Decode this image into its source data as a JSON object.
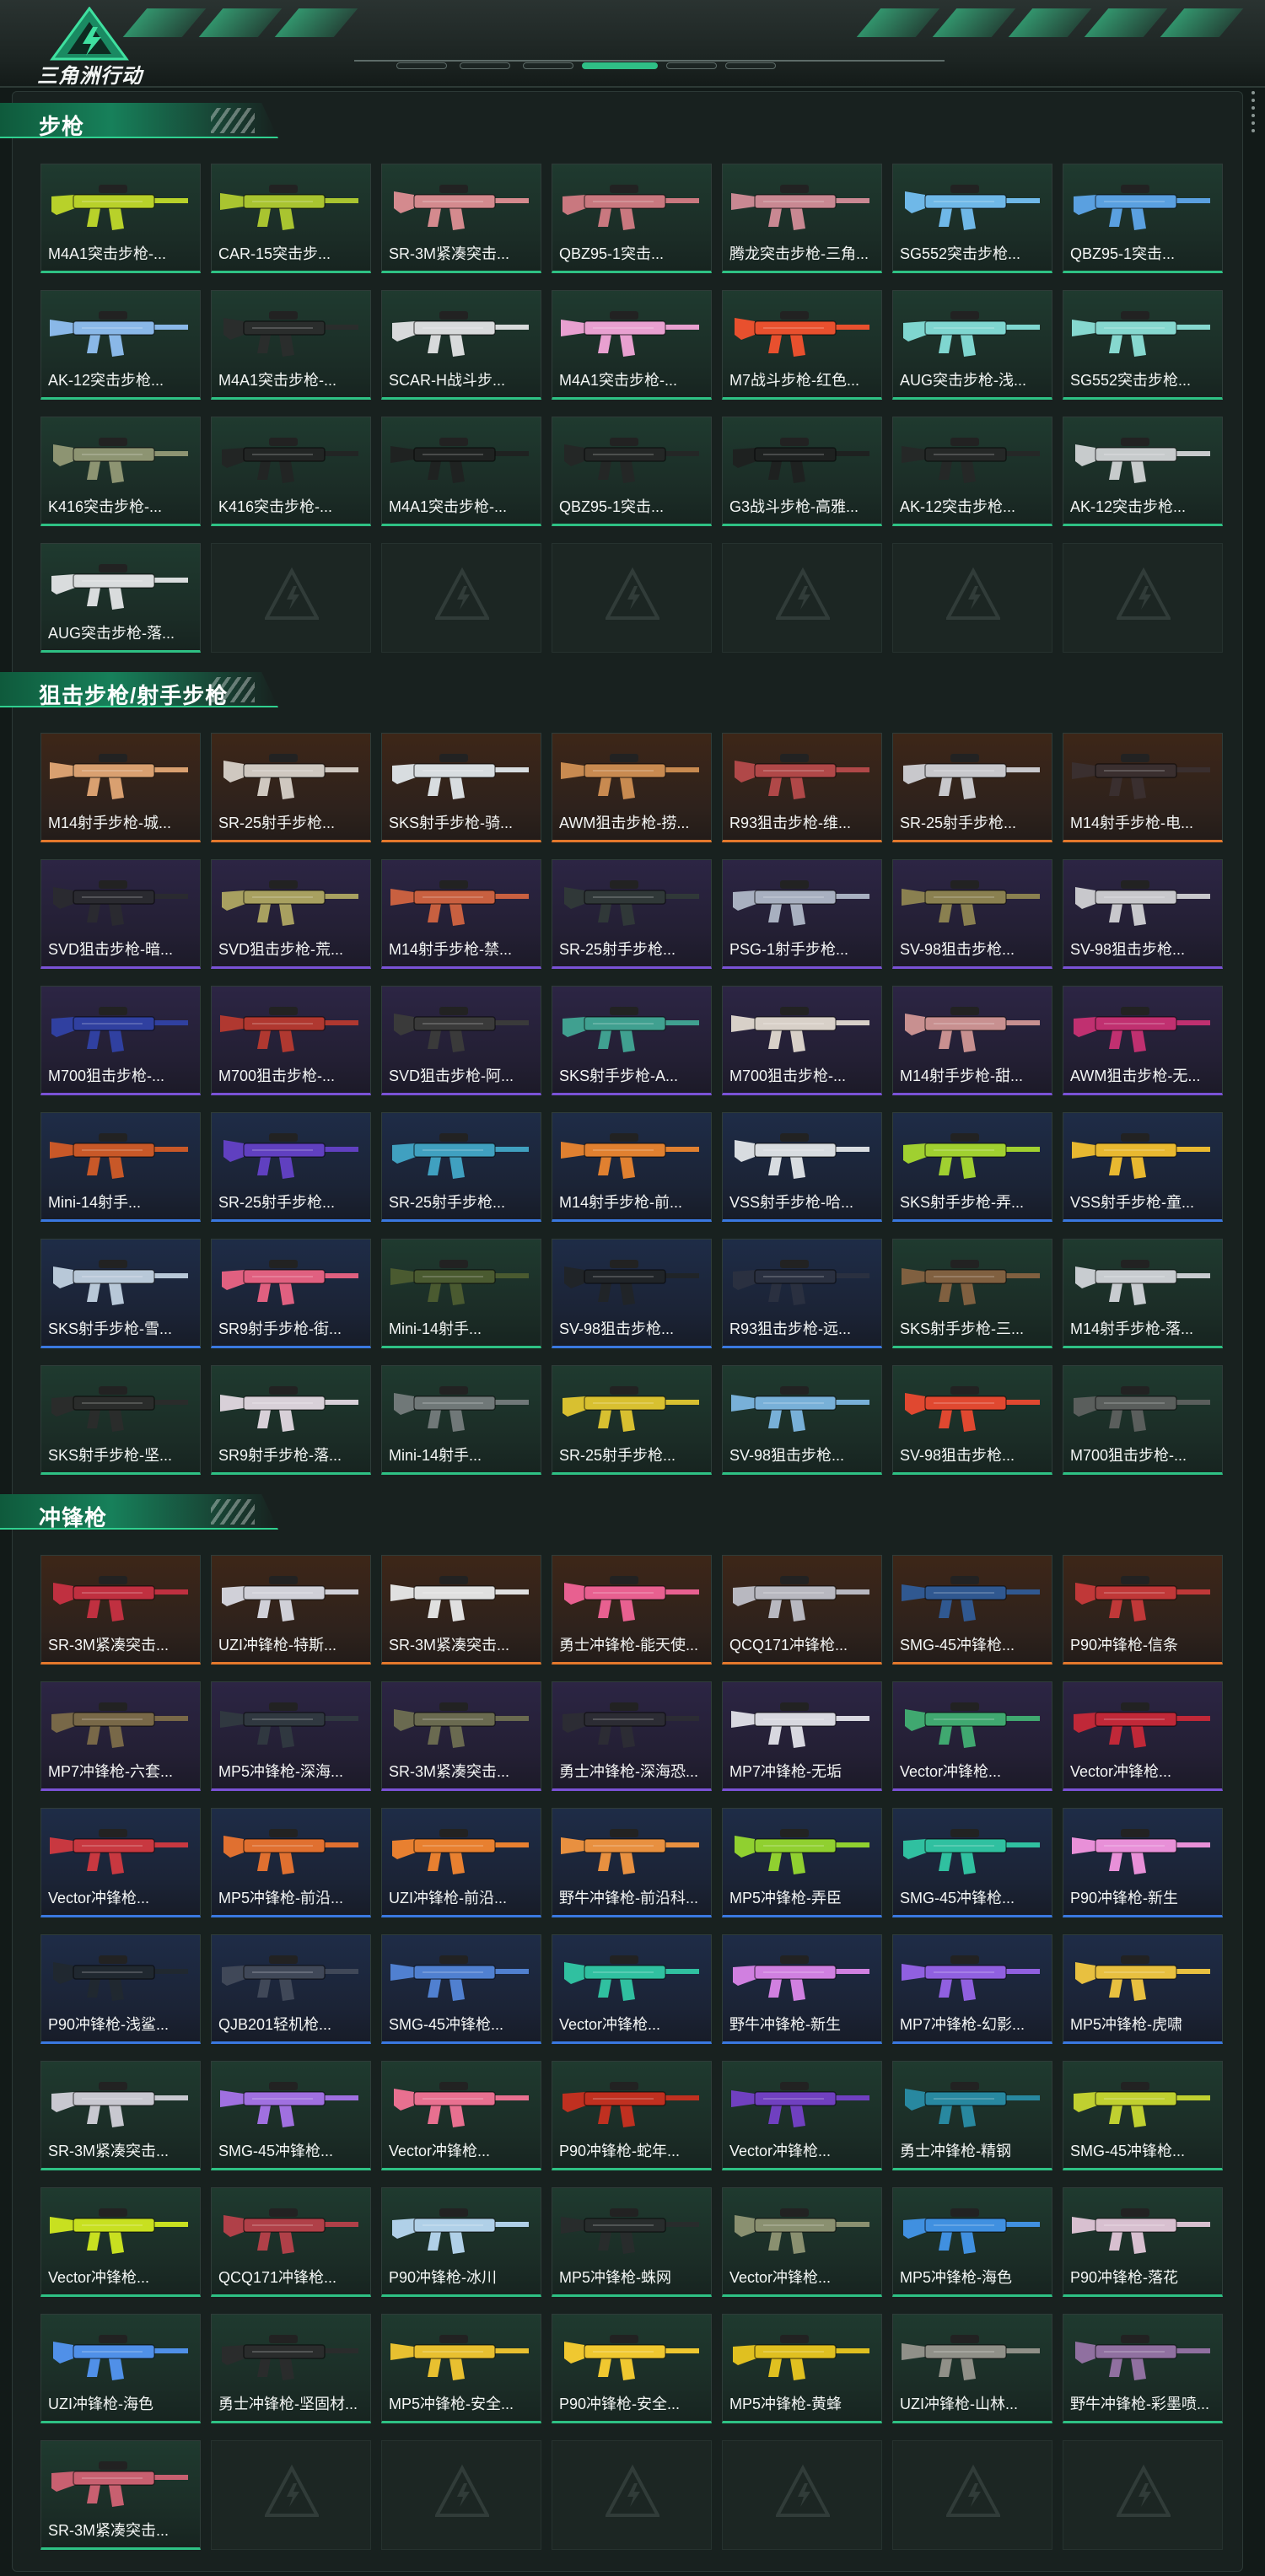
{
  "app": {
    "logo_text": "三角洲行动"
  },
  "colors": {
    "accent": "#2fd08f",
    "green": "#2ec184",
    "orange": "#e3782c",
    "purple": "#7a52d6",
    "blue": "#3a78e0"
  },
  "sections": [
    {
      "title": "步枪",
      "items": [
        {
          "name": "M4A1突击步枪-...",
          "rarity": "green",
          "color": "#b8d12a"
        },
        {
          "name": "CAR-15突击步...",
          "rarity": "green",
          "color": "#a9c430"
        },
        {
          "name": "SR-3M紧凑突击...",
          "rarity": "green",
          "color": "#d48a8e"
        },
        {
          "name": "QBZ95-1突击...",
          "rarity": "green",
          "color": "#c9787f"
        },
        {
          "name": "腾龙突击步枪-三角...",
          "rarity": "green",
          "color": "#c98892"
        },
        {
          "name": "SG552突击步枪...",
          "rarity": "green",
          "color": "#6fb8e8"
        },
        {
          "name": "QBZ95-1突击...",
          "rarity": "green",
          "color": "#5aa0e0"
        },
        {
          "name": "AK-12突击步枪...",
          "rarity": "green",
          "color": "#8ab8e8"
        },
        {
          "name": "M4A1突击步枪-...",
          "rarity": "green",
          "color": "#2a2d2c"
        },
        {
          "name": "SCAR-H战斗步...",
          "rarity": "green",
          "color": "#d8dadb"
        },
        {
          "name": "M4A1突击步枪-...",
          "rarity": "green",
          "color": "#e8a0d0"
        },
        {
          "name": "M7战斗步枪-红色...",
          "rarity": "green",
          "color": "#e8502e"
        },
        {
          "name": "AUG突击步枪-浅...",
          "rarity": "green",
          "color": "#7fd6d0"
        },
        {
          "name": "SG552突击步枪...",
          "rarity": "green",
          "color": "#86d8cf"
        },
        {
          "name": "K416突击步枪-...",
          "rarity": "green",
          "color": "#8d9472"
        },
        {
          "name": "K416突击步枪-...",
          "rarity": "green",
          "color": "#222524"
        },
        {
          "name": "M4A1突击步枪-...",
          "rarity": "green",
          "color": "#1f2221"
        },
        {
          "name": "QBZ95-1突击...",
          "rarity": "green",
          "color": "#242726"
        },
        {
          "name": "G3战斗步枪-高雅...",
          "rarity": "green",
          "color": "#1e2120"
        },
        {
          "name": "AK-12突击步枪...",
          "rarity": "green",
          "color": "#252827"
        },
        {
          "name": "AK-12突击步枪...",
          "rarity": "green",
          "color": "#c7cbcc"
        },
        {
          "name": "AUG突击步枪-落...",
          "rarity": "green",
          "color": "#d9dcdd"
        },
        {
          "name": "",
          "rarity": "empty"
        },
        {
          "name": "",
          "rarity": "empty"
        },
        {
          "name": "",
          "rarity": "empty"
        },
        {
          "name": "",
          "rarity": "empty"
        },
        {
          "name": "",
          "rarity": "empty"
        },
        {
          "name": "",
          "rarity": "empty"
        }
      ]
    },
    {
      "title": "狙击步枪/射手步枪",
      "items": [
        {
          "name": "M14射手步枪-城...",
          "rarity": "orange",
          "color": "#d9a070"
        },
        {
          "name": "SR-25射手步枪...",
          "rarity": "orange",
          "color": "#cfc8c0"
        },
        {
          "name": "SKS射手步枪-骑...",
          "rarity": "orange",
          "color": "#d8dde0"
        },
        {
          "name": "AWM狙击步枪-捞...",
          "rarity": "orange",
          "color": "#c88a50"
        },
        {
          "name": "R93狙击步枪-维...",
          "rarity": "orange",
          "color": "#b04848"
        },
        {
          "name": "SR-25射手步枪...",
          "rarity": "orange",
          "color": "#c8c8cc"
        },
        {
          "name": "M14射手步枪-电...",
          "rarity": "orange",
          "color": "#3a2f2f"
        },
        {
          "name": "SVD狙击步枪-暗...",
          "rarity": "purple",
          "color": "#2a2a30"
        },
        {
          "name": "SVD狙击步枪-荒...",
          "rarity": "purple",
          "color": "#a8a060"
        },
        {
          "name": "M14射手步枪-禁...",
          "rarity": "purple",
          "color": "#c86040"
        },
        {
          "name": "SR-25射手步枪...",
          "rarity": "purple",
          "color": "#303838"
        },
        {
          "name": "PSG-1射手步枪...",
          "rarity": "purple",
          "color": "#a8b0c0"
        },
        {
          "name": "SV-98狙击步枪...",
          "rarity": "purple",
          "color": "#8a8050"
        },
        {
          "name": "SV-98狙击步枪...",
          "rarity": "purple",
          "color": "#c8c8cc"
        },
        {
          "name": "M700狙击步枪-...",
          "rarity": "purple",
          "color": "#3040a0"
        },
        {
          "name": "M700狙击步枪-...",
          "rarity": "purple",
          "color": "#b03830"
        },
        {
          "name": "SVD狙击步枪-阿...",
          "rarity": "purple",
          "color": "#3a3a3a"
        },
        {
          "name": "SKS射手步枪-A...",
          "rarity": "purple",
          "color": "#40a090"
        },
        {
          "name": "M700狙击步枪-...",
          "rarity": "purple",
          "color": "#d8d0c8"
        },
        {
          "name": "M14射手步枪-甜...",
          "rarity": "purple",
          "color": "#c89090"
        },
        {
          "name": "AWM狙击步枪-无...",
          "rarity": "purple",
          "color": "#c03070"
        },
        {
          "name": "Mini-14射手...",
          "rarity": "blue",
          "color": "#c85828"
        },
        {
          "name": "SR-25射手步枪...",
          "rarity": "blue",
          "color": "#6040c0"
        },
        {
          "name": "SR-25射手步枪...",
          "rarity": "blue",
          "color": "#40a0c0"
        },
        {
          "name": "M14射手步枪-前...",
          "rarity": "blue",
          "color": "#e08030"
        },
        {
          "name": "VSS射手步枪-哈...",
          "rarity": "blue",
          "color": "#d8dce0"
        },
        {
          "name": "SKS射手步枪-弄...",
          "rarity": "blue",
          "color": "#a0d030"
        },
        {
          "name": "VSS射手步枪-童...",
          "rarity": "blue",
          "color": "#e8b830"
        },
        {
          "name": "SKS射手步枪-雪...",
          "rarity": "blue",
          "color": "#b8c8d8"
        },
        {
          "name": "SR9射手步枪-街...",
          "rarity": "blue",
          "color": "#e06080"
        },
        {
          "name": "Mini-14射手...",
          "rarity": "green",
          "color": "#4a5a30"
        },
        {
          "name": "SV-98狙击步枪...",
          "rarity": "blue",
          "color": "#202428"
        },
        {
          "name": "R93狙击步枪-远...",
          "rarity": "blue",
          "color": "#2a3040"
        },
        {
          "name": "SKS射手步枪-三...",
          "rarity": "green",
          "color": "#806040"
        },
        {
          "name": "M14射手步枪-落...",
          "rarity": "green",
          "color": "#c8ccd0"
        },
        {
          "name": "SKS射手步枪-坚...",
          "rarity": "green",
          "color": "#2a2c2b"
        },
        {
          "name": "SR9射手步枪-落...",
          "rarity": "green",
          "color": "#d8d0d8"
        },
        {
          "name": "Mini-14射手...",
          "rarity": "green",
          "color": "#707878"
        },
        {
          "name": "SR-25射手步枪...",
          "rarity": "green",
          "color": "#d8c030"
        },
        {
          "name": "SV-98狙击步枪...",
          "rarity": "green",
          "color": "#78b0d8"
        },
        {
          "name": "SV-98狙击步枪...",
          "rarity": "green",
          "color": "#e04830"
        },
        {
          "name": "M700狙击步枪-...",
          "rarity": "green",
          "color": "#5a5e5c"
        }
      ]
    },
    {
      "title": "冲锋枪",
      "items": [
        {
          "name": "SR-3M紧凑突击...",
          "rarity": "orange",
          "color": "#c03040"
        },
        {
          "name": "UZI冲锋枪-特斯...",
          "rarity": "orange",
          "color": "#d0d0d8"
        },
        {
          "name": "SR-3M紧凑突击...",
          "rarity": "orange",
          "color": "#e0e0e0"
        },
        {
          "name": "勇士冲锋枪-能天使...",
          "rarity": "orange",
          "color": "#e86090"
        },
        {
          "name": "QCQ171冲锋枪...",
          "rarity": "orange",
          "color": "#b8b8c0"
        },
        {
          "name": "SMG-45冲锋枪...",
          "rarity": "orange",
          "color": "#305890"
        },
        {
          "name": "P90冲锋枪-信条",
          "rarity": "orange",
          "color": "#c03838"
        },
        {
          "name": "MP7冲锋枪-六套...",
          "rarity": "purple",
          "color": "#786848"
        },
        {
          "name": "MP5冲锋枪-深海...",
          "rarity": "purple",
          "color": "#303840"
        },
        {
          "name": "SR-3M紧凑突击...",
          "rarity": "purple",
          "color": "#6a6a50"
        },
        {
          "name": "勇士冲锋枪-深海恐...",
          "rarity": "purple",
          "color": "#2c2c34"
        },
        {
          "name": "MP7冲锋枪-无垢",
          "rarity": "purple",
          "color": "#d8d8e0"
        },
        {
          "name": "Vector冲锋枪...",
          "rarity": "purple",
          "color": "#40a870"
        },
        {
          "name": "Vector冲锋枪...",
          "rarity": "purple",
          "color": "#c02838"
        },
        {
          "name": "Vector冲锋枪...",
          "rarity": "blue",
          "color": "#c83840"
        },
        {
          "name": "MP5冲锋枪-前沿...",
          "rarity": "blue",
          "color": "#e07030"
        },
        {
          "name": "UZI冲锋枪-前沿...",
          "rarity": "blue",
          "color": "#e88030"
        },
        {
          "name": "野牛冲锋枪-前沿科...",
          "rarity": "blue",
          "color": "#e89040"
        },
        {
          "name": "MP5冲锋枪-弄臣",
          "rarity": "blue",
          "color": "#90d030"
        },
        {
          "name": "SMG-45冲锋枪...",
          "rarity": "blue",
          "color": "#30c0a0"
        },
        {
          "name": "P90冲锋枪-新生",
          "rarity": "blue",
          "color": "#e890d8"
        },
        {
          "name": "P90冲锋枪-浅鲨...",
          "rarity": "blue",
          "color": "#202830"
        },
        {
          "name": "QJB201轻机枪...",
          "rarity": "blue",
          "color": "#404858"
        },
        {
          "name": "SMG-45冲锋枪...",
          "rarity": "blue",
          "color": "#5080d0"
        },
        {
          "name": "Vector冲锋枪...",
          "rarity": "blue",
          "color": "#30c0a0"
        },
        {
          "name": "野牛冲锋枪-新生",
          "rarity": "blue",
          "color": "#d080e0"
        },
        {
          "name": "MP7冲锋枪-幻影...",
          "rarity": "blue",
          "color": "#9060e0"
        },
        {
          "name": "MP5冲锋枪-虎啸",
          "rarity": "blue",
          "color": "#e8c040"
        },
        {
          "name": "SR-3M紧凑突击...",
          "rarity": "green",
          "color": "#c8c8d0"
        },
        {
          "name": "SMG-45冲锋枪...",
          "rarity": "green",
          "color": "#a070e0"
        },
        {
          "name": "Vector冲锋枪...",
          "rarity": "green",
          "color": "#e87090"
        },
        {
          "name": "P90冲锋枪-蛇年...",
          "rarity": "green",
          "color": "#c03020"
        },
        {
          "name": "Vector冲锋枪...",
          "rarity": "green",
          "color": "#7040c0"
        },
        {
          "name": "勇士冲锋枪-精钢",
          "rarity": "green",
          "color": "#2888a0"
        },
        {
          "name": "SMG-45冲锋枪...",
          "rarity": "green",
          "color": "#c0d030"
        },
        {
          "name": "Vector冲锋枪...",
          "rarity": "green",
          "color": "#c8e020"
        },
        {
          "name": "QCQ171冲锋枪...",
          "rarity": "green",
          "color": "#b04048"
        },
        {
          "name": "P90冲锋枪-冰川",
          "rarity": "green",
          "color": "#b0d0e8"
        },
        {
          "name": "MP5冲锋枪-蛛网",
          "rarity": "green",
          "color": "#282c2c"
        },
        {
          "name": "Vector冲锋枪...",
          "rarity": "green",
          "color": "#8a9070"
        },
        {
          "name": "MP5冲锋枪-海色",
          "rarity": "green",
          "color": "#4090e0"
        },
        {
          "name": "P90冲锋枪-落花",
          "rarity": "green",
          "color": "#d8c0d0"
        },
        {
          "name": "UZI冲锋枪-海色",
          "rarity": "green",
          "color": "#5090e8"
        },
        {
          "name": "勇士冲锋枪-坚固材...",
          "rarity": "green",
          "color": "#2a2c2c"
        },
        {
          "name": "MP5冲锋枪-安全...",
          "rarity": "green",
          "color": "#e8c030"
        },
        {
          "name": "P90冲锋枪-安全...",
          "rarity": "green",
          "color": "#f0c830"
        },
        {
          "name": "MP5冲锋枪-黄蜂",
          "rarity": "green",
          "color": "#e0c020"
        },
        {
          "name": "UZI冲锋枪-山林...",
          "rarity": "green",
          "color": "#909088"
        },
        {
          "name": "野牛冲锋枪-彩墨喷...",
          "rarity": "green",
          "color": "#9070a0"
        },
        {
          "name": "SR-3M紧凑突击...",
          "rarity": "green",
          "color": "#c86070"
        },
        {
          "name": "",
          "rarity": "empty"
        },
        {
          "name": "",
          "rarity": "empty"
        },
        {
          "name": "",
          "rarity": "empty"
        },
        {
          "name": "",
          "rarity": "empty"
        },
        {
          "name": "",
          "rarity": "empty"
        },
        {
          "name": "",
          "rarity": "empty"
        }
      ]
    }
  ]
}
